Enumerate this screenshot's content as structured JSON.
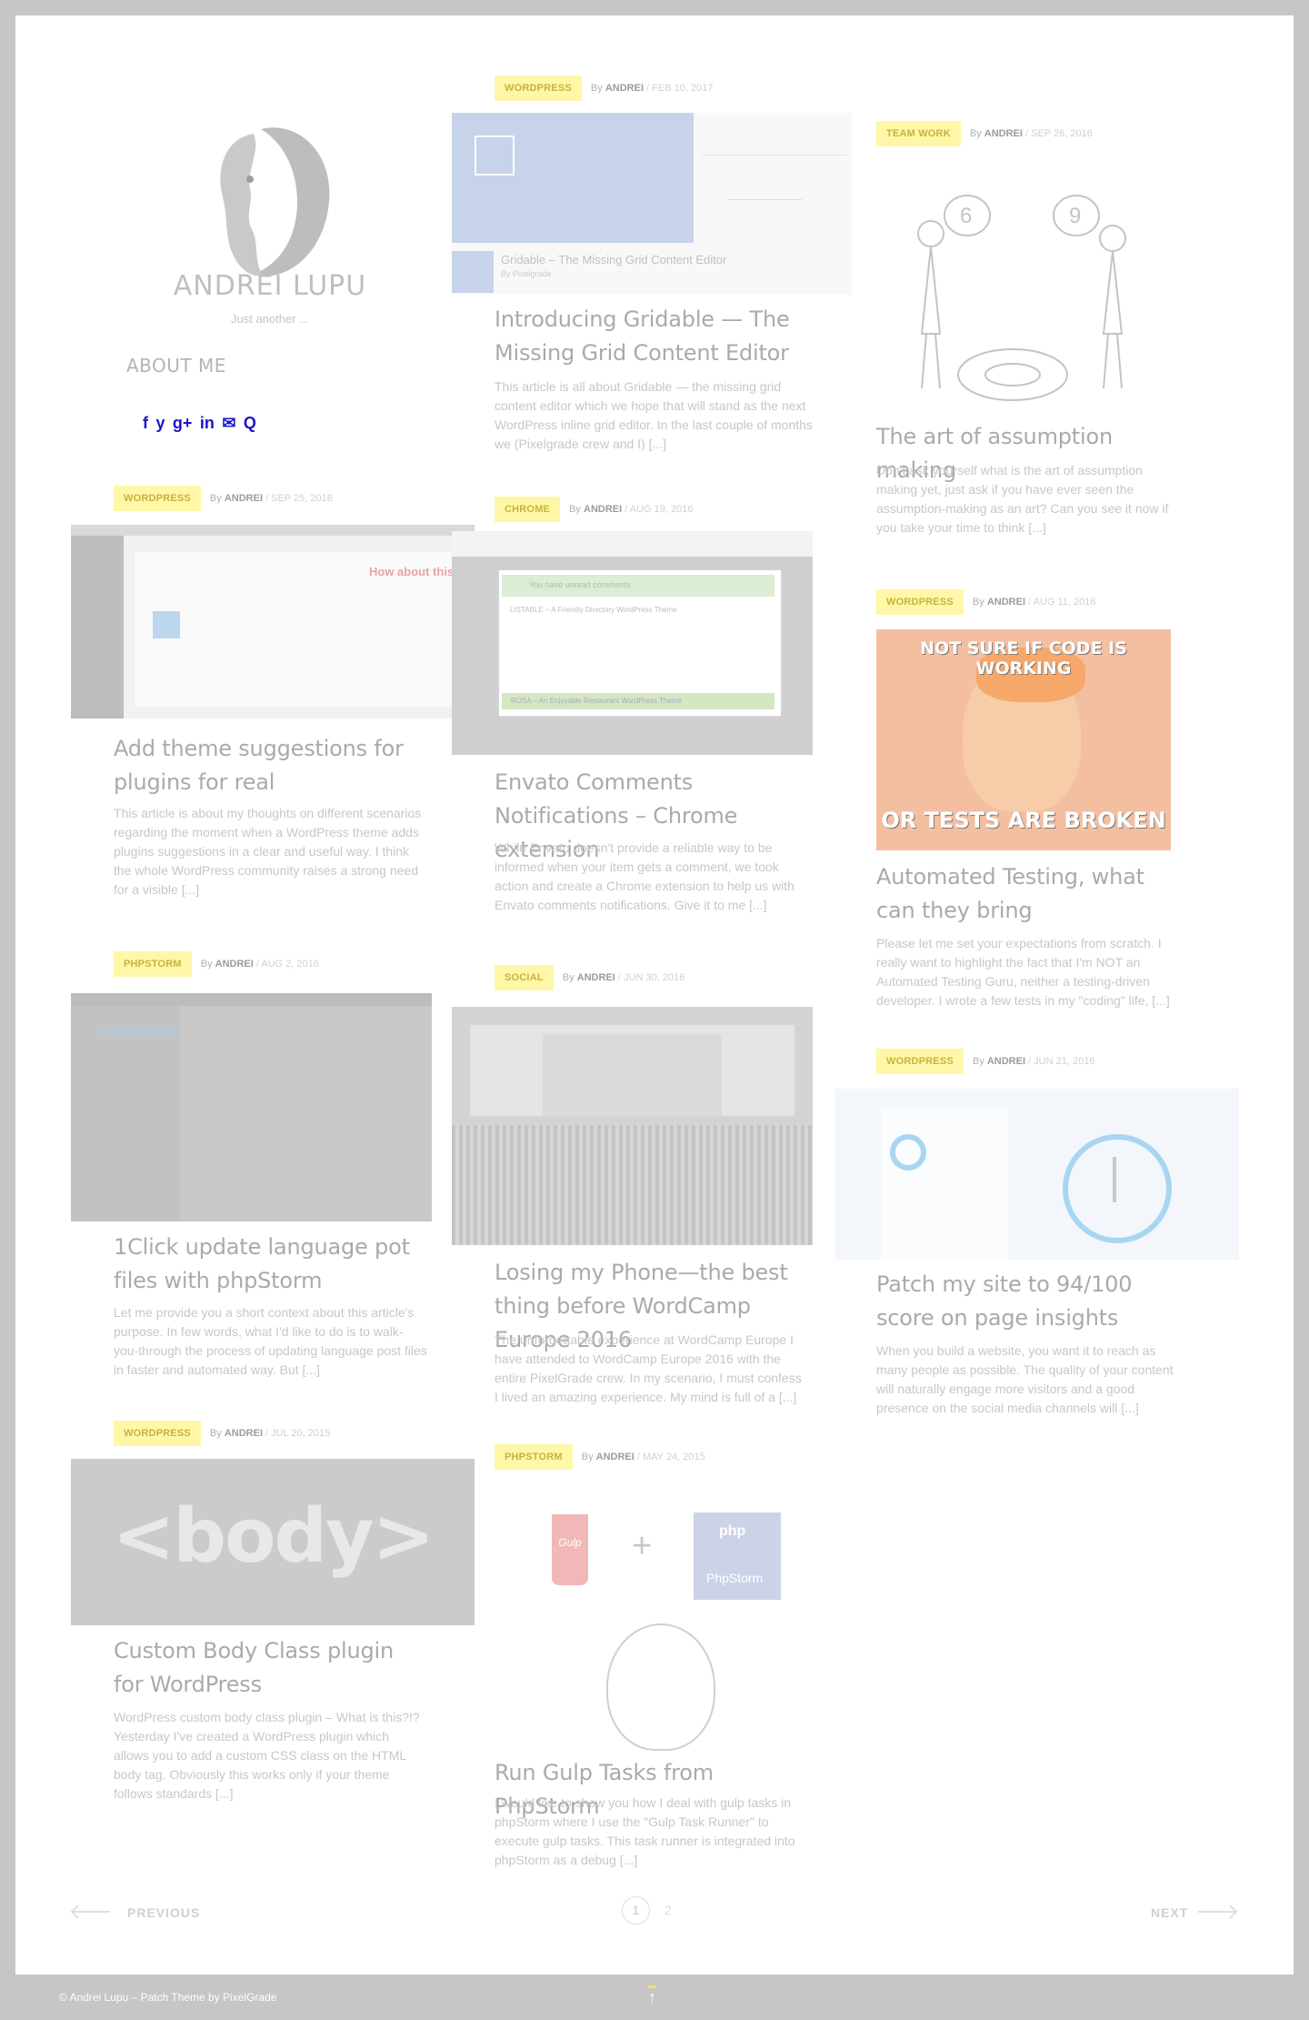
{
  "site": {
    "name": "ANDREI LUPU",
    "tagline": "Just another ...",
    "menu_about": "ABOUT ME",
    "social": [
      "f",
      "y",
      "g+",
      "in",
      "✉",
      "Q"
    ]
  },
  "posts": [
    {
      "category": "WORDPRESS",
      "author": "ANDREI",
      "date": "FEB 10, 2017",
      "title": "Introducing Gridable — The Missing Grid Content Editor",
      "excerpt": "This article is all about Gridable — the missing grid content editor which we hope that will stand as the next WordPress inline grid editor. In the last couple of months we (Pixelgrade crew and I) [...]",
      "image_caption": "Gridable – The Missing Grid Content Editor",
      "image_small": "By Pixelgrade"
    },
    {
      "category": "TEAM WORK",
      "author": "ANDREI",
      "date": "SEP 26, 2016",
      "title": "The art of assumption making",
      "excerpt": "Don't ask yourself what is the art of assumption making yet, just ask if you have ever seen the assumption-making as an art? Can you see it now if you take your time to think [...]"
    },
    {
      "category": "WORDPRESS",
      "author": "ANDREI",
      "date": "SEP 25, 2016",
      "title": "Add theme suggestions for plugins for real",
      "excerpt": "This article is about my thoughts on different scenarios regarding the moment when a WordPress theme adds plugins suggestions in a clear and useful way. I think the whole WordPress community raises a strong need for a visible [...]",
      "image_callout": "How about this?"
    },
    {
      "category": "CHROME",
      "author": "ANDREI",
      "date": "AUG 19, 2016",
      "title": "Envato Comments Notifications – Chrome extension",
      "excerpt": "While Envato doesn't provide a reliable way to be informed when your item gets a comment, we took action and create a Chrome extension to help us with Envato comments notifications. Give it to me [...]",
      "image_notice": "You have unread comments",
      "image_item1": "LISTABLE – A Friendly Directory WordPress Theme",
      "image_item2": "ROSA – An Enjoyable Restaurant WordPress Theme"
    },
    {
      "category": "WORDPRESS",
      "author": "ANDREI",
      "date": "AUG 11, 2016",
      "title": "Automated Testing, what can they bring",
      "excerpt": "Please let me set your expectations from scratch. I really want to highlight the fact that I'm NOT an Automated Testing Guru, neither a testing-driven developer. I wrote a few tests in my \"coding\" life, [...]",
      "meme_top": "NOT SURE IF CODE IS WORKING",
      "meme_bottom": "OR TESTS ARE BROKEN"
    },
    {
      "category": "PHPSTORM",
      "author": "ANDREI",
      "date": "AUG 2, 2016",
      "title": "1Click update language pot files with phpStorm",
      "excerpt": "Let me provide you a short context about this article's purpose. In few words, what I'd like to do is to walk-you-through the process of updating language post files in faster and automated way. But [...]"
    },
    {
      "category": "SOCIAL",
      "author": "ANDREI",
      "date": "JUN 30, 2016",
      "title": "Losing my Phone—the best thing before WordCamp Europe 2016",
      "excerpt": "The unforgettable experience at WordCamp Europe I have attended to WordCamp Europe 2016 with the entire PixelGrade crew. In my scenario, I must confess I lived an amazing experience. My mind is full of a [...]"
    },
    {
      "category": "WORDPRESS",
      "author": "ANDREI",
      "date": "JUN 21, 2016",
      "title": "Patch my site to 94/100 score on page insights",
      "excerpt": "When you build a website, you want it to reach as many people as possible. The quality of your content will naturally engage more visitors and a good presence on the social media channels will [...]"
    },
    {
      "category": "WORDPRESS",
      "author": "ANDREI",
      "date": "JUL 20, 2015",
      "title": "Custom Body Class plugin for WordPress",
      "excerpt": "WordPress custom body class plugin – What is this?!? Yesterday I've created a WordPress plugin which allows you to add a custom CSS class on the HTML body tag. Obviously this works only if your theme follows standards [...]",
      "image_text": "<body>"
    },
    {
      "category": "PHPSTORM",
      "author": "ANDREI",
      "date": "MAY 24, 2015",
      "title": "Run Gulp Tasks from PhpStorm",
      "excerpt": "I would like to show you how I deal with gulp tasks in phpStorm where I use the \"Gulp Task Runner\" to execute gulp tasks. This task runner is integrated into phpStorm as a debug [...]",
      "image_gulp": "Gulp",
      "image_plus": "+",
      "image_php": "php",
      "image_phpstorm": "PhpStorm"
    }
  ],
  "pagination": {
    "prev": "PREVIOUS",
    "next": "NEXT",
    "pages": [
      "1",
      "2"
    ],
    "current": "1"
  },
  "footer": {
    "copyright": "© Andrei Lupu – Patch Theme by",
    "brand": "PixelGrade",
    "top_icon": "↑"
  },
  "colors": {
    "category_bg": "#fff7a8",
    "category_text": "#c8b33b",
    "page_bg": "#c6c6c6",
    "social_link": "#1a14c9"
  }
}
